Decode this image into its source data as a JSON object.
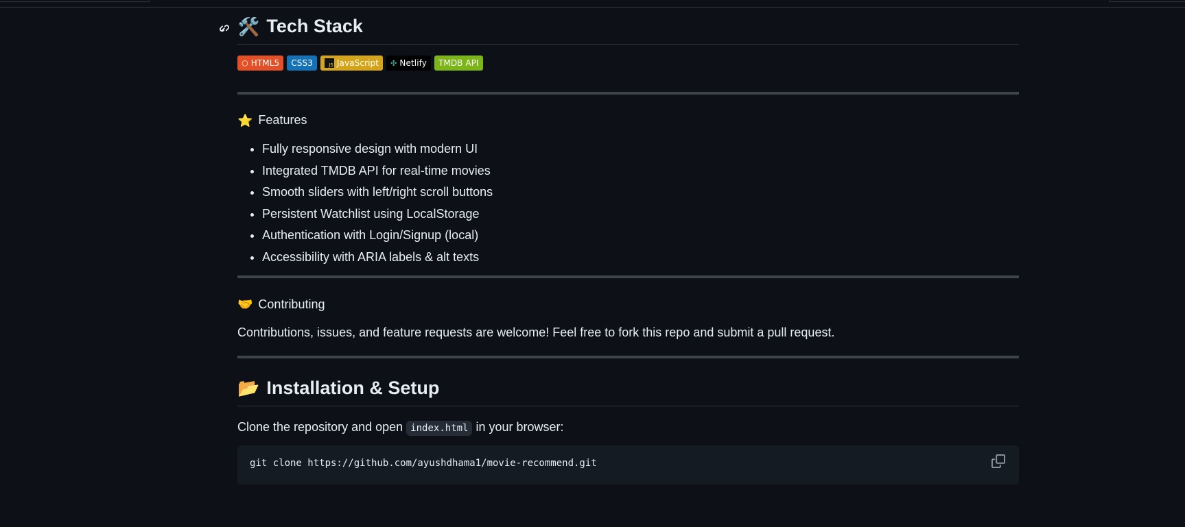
{
  "tech_stack": {
    "heading": "Tech Stack",
    "emoji": "🛠️",
    "badges": [
      {
        "label": "HTML5",
        "bg": "#e34f26",
        "icon": "html5-icon"
      },
      {
        "label": "CSS3",
        "bg": "#1572b6",
        "icon": ""
      },
      {
        "label": "JavaScript",
        "bg": "#d4a51b",
        "icon": "javascript-icon"
      },
      {
        "label": "Netlify",
        "bg": "#000000",
        "icon": "netlify-icon"
      },
      {
        "label": "TMDB API",
        "bg": "#7cb518",
        "icon": ""
      }
    ]
  },
  "features": {
    "emoji": "⭐",
    "title": "Features",
    "items": [
      "Fully responsive design with modern UI",
      "Integrated TMDB API for real-time movies",
      "Smooth sliders with left/right scroll buttons",
      "Persistent Watchlist using LocalStorage",
      "Authentication with Login/Signup (local)",
      "Accessibility with ARIA labels & alt texts"
    ]
  },
  "contributing": {
    "emoji": "🤝",
    "title": "Contributing",
    "text": "Contributions, issues, and feature requests are welcome! Feel free to fork this repo and submit a pull request."
  },
  "installation": {
    "emoji": "📂",
    "heading": "Installation & Setup",
    "intro_before": "Clone the repository and open ",
    "intro_code": "index.html",
    "intro_after": " in your browser:",
    "command": "git clone https://github.com/ayushdhama1/movie-recommend.git"
  },
  "colors": {
    "background": "#0d1117",
    "border": "#30363d",
    "rule": "#3d444d",
    "code_bg": "#151b23",
    "text": "#e6edf3"
  }
}
